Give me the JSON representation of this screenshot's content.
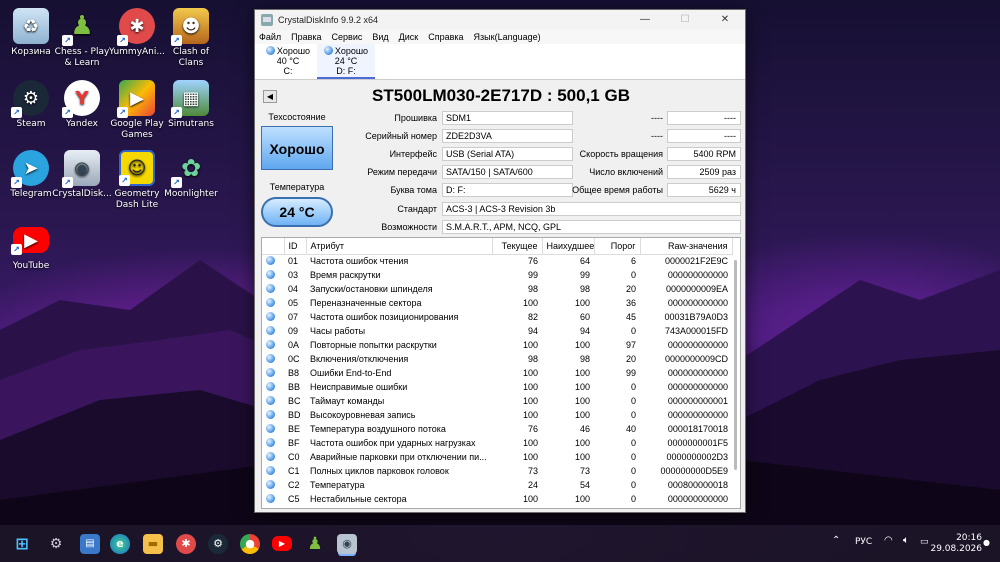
{
  "desktop": {
    "icons": [
      {
        "label": "Корзина",
        "icon": "recycle-bin-icon"
      },
      {
        "label": "Chess - Play & Learn",
        "icon": "chess-icon"
      },
      {
        "label": "YummyAni...",
        "icon": "yummy-anime-icon"
      },
      {
        "label": "Clash of Clans",
        "icon": "clash-of-clans-icon"
      },
      {
        "label": "Steam",
        "icon": "steam-icon"
      },
      {
        "label": "Yandex",
        "icon": "yandex-icon"
      },
      {
        "label": "Google Play Games",
        "icon": "google-play-games-icon"
      },
      {
        "label": "Simutrans",
        "icon": "simutrans-icon"
      },
      {
        "label": "Telegram",
        "icon": "telegram-icon"
      },
      {
        "label": "CrystalDisk...",
        "icon": "crystaldisk-icon"
      },
      {
        "label": "Geometry Dash Lite",
        "icon": "geometry-dash-icon"
      },
      {
        "label": "Moonlighter",
        "icon": "moonlighter-icon"
      },
      {
        "label": "YouTube",
        "icon": "youtube-icon"
      }
    ]
  },
  "window": {
    "title": "CrystalDiskInfo 9.9.2 x64",
    "controls": {
      "minimize": "—",
      "maximize": "☐",
      "close": "✕"
    },
    "menu": [
      "Файл",
      "Правка",
      "Сервис",
      "Вид",
      "Диск",
      "Справка",
      "Язык(Language)"
    ],
    "disks": [
      {
        "status": "Хорошо",
        "temp": "40 °C",
        "letter": "C:"
      },
      {
        "status": "Хорошо",
        "temp": "24 °C",
        "letter": "D: F:"
      }
    ],
    "nav_prev": "◀",
    "model": "ST500LM030-2E717D : 500,1 GB",
    "health_label": "Техсостояние",
    "health_value": "Хорошо",
    "temp_label": "Температура",
    "temp_value": "24 °C",
    "info": {
      "firmware_label": "Прошивка",
      "firmware": "SDM1",
      "serial_label": "Серийный номер",
      "serial": "ZDE2D3VA",
      "interface_label": "Интерфейс",
      "interface": "USB (Serial ATA)",
      "transfer_label": "Режим передачи",
      "transfer": "SATA/150 | SATA/600",
      "volume_label": "Буква тома",
      "volume": "D: F:",
      "standard_label": "Стандарт",
      "standard": "ACS-3 | ACS-3 Revision 3b",
      "features_label": "Возможности",
      "features": "S.M.A.R.T., APM, NCQ, GPL",
      "blank1_label": "----",
      "blank1": "----",
      "blank2_label": "----",
      "blank2": "----",
      "rotation_label": "Скорость вращения",
      "rotation": "5400 RPM",
      "power_count_label": "Число включений",
      "power_count": "2509 раз",
      "power_hours_label": "Общее время работы",
      "power_hours": "5629 ч"
    },
    "table": {
      "headers": [
        "ID",
        "Атрибут",
        "Текущее",
        "Наихудшее",
        "Порог",
        "Raw-значения"
      ],
      "rows": [
        [
          "01",
          "Частота ошибок чтения",
          "76",
          "64",
          "6",
          "0000021F2E9C"
        ],
        [
          "03",
          "Время раскрутки",
          "99",
          "99",
          "0",
          "000000000000"
        ],
        [
          "04",
          "Запуски/остановки шпинделя",
          "98",
          "98",
          "20",
          "0000000009EA"
        ],
        [
          "05",
          "Переназначенные сектора",
          "100",
          "100",
          "36",
          "000000000000"
        ],
        [
          "07",
          "Частота ошибок позиционирования",
          "82",
          "60",
          "45",
          "00031B79A0D3"
        ],
        [
          "09",
          "Часы работы",
          "94",
          "94",
          "0",
          "743A000015FD"
        ],
        [
          "0A",
          "Повторные попытки раскрутки",
          "100",
          "100",
          "97",
          "000000000000"
        ],
        [
          "0C",
          "Включения/отключения",
          "98",
          "98",
          "20",
          "0000000009CD"
        ],
        [
          "B8",
          "Ошибки End-to-End",
          "100",
          "100",
          "99",
          "000000000000"
        ],
        [
          "BB",
          "Неисправимые ошибки",
          "100",
          "100",
          "0",
          "000000000000"
        ],
        [
          "BC",
          "Таймаут команды",
          "100",
          "100",
          "0",
          "000000000001"
        ],
        [
          "BD",
          "Высокоуровневая запись",
          "100",
          "100",
          "0",
          "000000000000"
        ],
        [
          "BE",
          "Температура воздушного потока",
          "76",
          "46",
          "40",
          "000018170018"
        ],
        [
          "BF",
          "Частота ошибок при ударных нагрузках",
          "100",
          "100",
          "0",
          "0000000001F5"
        ],
        [
          "C0",
          "Аварийные парковки при отключении пи...",
          "100",
          "100",
          "0",
          "0000000002D3"
        ],
        [
          "C1",
          "Полных циклов парковок головок",
          "73",
          "73",
          "0",
          "000000000D5E9"
        ],
        [
          "C2",
          "Температура",
          "24",
          "54",
          "0",
          "000800000018"
        ],
        [
          "C5",
          "Нестабильные сектора",
          "100",
          "100",
          "0",
          "000000000000"
        ]
      ]
    }
  },
  "taskbar": {
    "lang": "РУС",
    "time": "20:16",
    "date": "29.08.2026"
  }
}
